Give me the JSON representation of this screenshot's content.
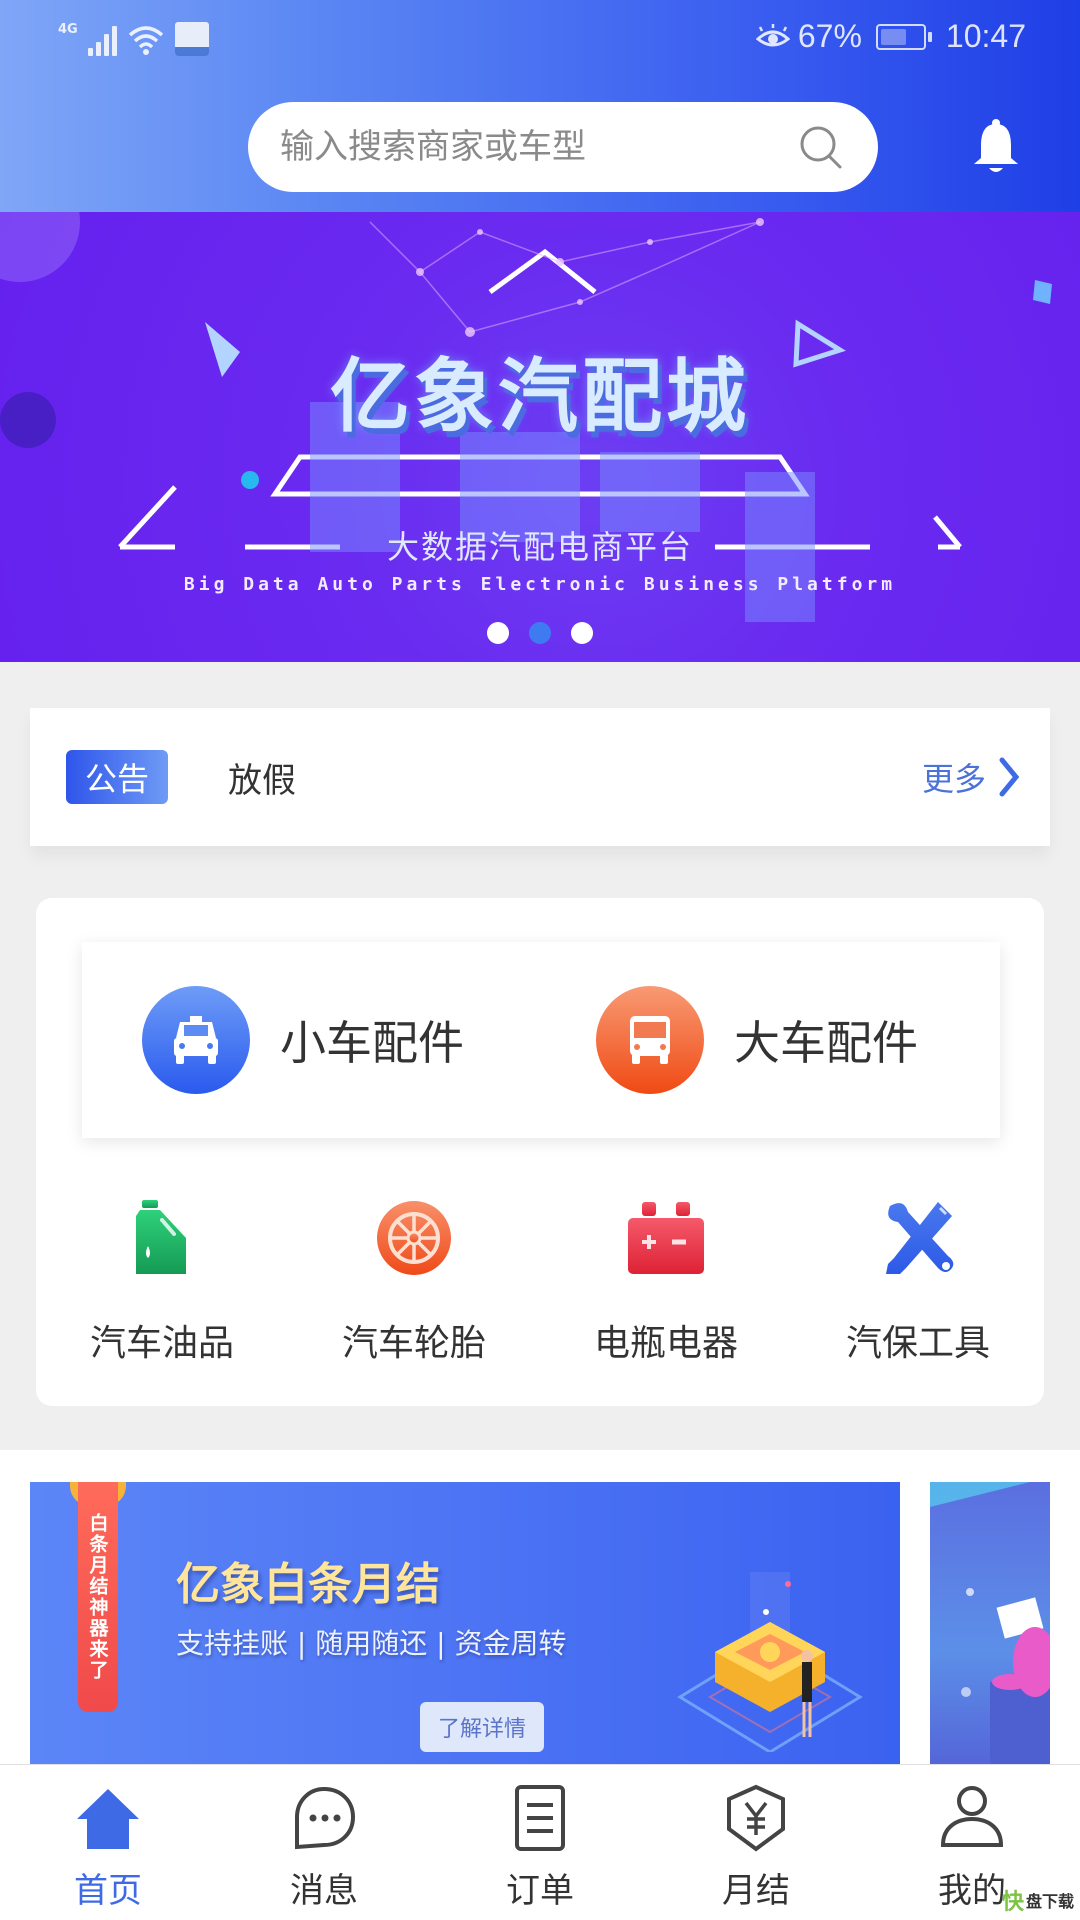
{
  "status_bar": {
    "network": "4G",
    "eye_comfort": "eye-icon",
    "battery_percent": "67%",
    "battery_level": 0.67,
    "time": "10:47"
  },
  "header": {
    "search_placeholder": "输入搜索商家或车型",
    "search_icon": "search-icon",
    "bell_icon": "bell-icon"
  },
  "banner": {
    "title": "亿象汽配城",
    "subtitle": "大数据汽配电商平台",
    "subtitle_en": "Big Data Auto Parts Electronic Business Platform",
    "slide_count": 3,
    "active_slide": 2
  },
  "notice": {
    "tag": "公告",
    "text": "放假",
    "more": "更多"
  },
  "categories": {
    "primary": [
      {
        "label": "小车配件",
        "icon": "car-icon",
        "color": "#3a6af0"
      },
      {
        "label": "大车配件",
        "icon": "bus-icon",
        "color": "#f05a28"
      }
    ],
    "secondary": [
      {
        "label": "汽车油品",
        "icon": "oil-can-icon"
      },
      {
        "label": "汽车轮胎",
        "icon": "tire-icon"
      },
      {
        "label": "电瓶电器",
        "icon": "battery-icon"
      },
      {
        "label": "汽保工具",
        "icon": "tools-icon"
      }
    ]
  },
  "promo": {
    "ribbon": "白条月结神器来了",
    "title": "亿象白条月结",
    "subtitle": "支持挂账 | 随用随还 | 资金周转",
    "button": "了解详情"
  },
  "tabbar": {
    "items": [
      {
        "label": "首页",
        "icon": "home-icon",
        "active": true
      },
      {
        "label": "消息",
        "icon": "message-icon",
        "active": false
      },
      {
        "label": "订单",
        "icon": "order-icon",
        "active": false
      },
      {
        "label": "月结",
        "icon": "monthly-bill-icon",
        "active": false
      },
      {
        "label": "我的",
        "icon": "profile-icon",
        "active": false
      }
    ]
  },
  "watermark": {
    "k": "快",
    "text": "盘下载"
  },
  "colors": {
    "accent": "#3f6ae6",
    "header_start": "#7fa6f7",
    "header_end": "#1f3fe6",
    "banner_bg": "#6520ee"
  }
}
